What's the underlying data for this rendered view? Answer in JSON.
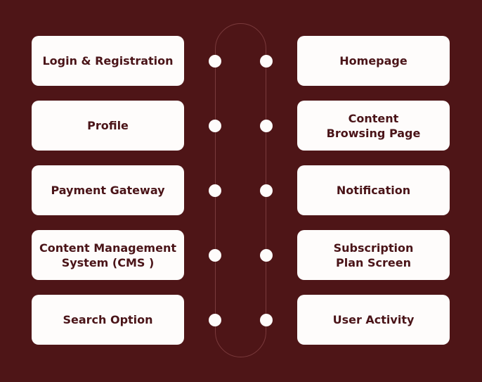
{
  "left_items": [
    {
      "label": "Login & Registration"
    },
    {
      "label": "Profile"
    },
    {
      "label": "Payment Gateway"
    },
    {
      "label": "Content Management\nSystem (CMS )"
    },
    {
      "label": "Search Option"
    }
  ],
  "right_items": [
    {
      "label": "Homepage"
    },
    {
      "label": "Content\nBrowsing Page"
    },
    {
      "label": "Notification"
    },
    {
      "label": "Subscription\nPlan Screen"
    },
    {
      "label": "User Activity"
    }
  ],
  "colors": {
    "background": "#4e1517",
    "card": "#fefcfb",
    "text": "#4a1418",
    "track": "#7a3a3c"
  }
}
